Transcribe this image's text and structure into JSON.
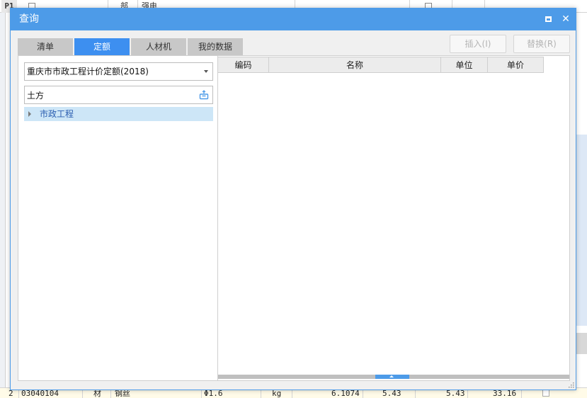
{
  "background": {
    "top_row": {
      "row_id": "P1",
      "type": "部",
      "name": "强电"
    },
    "bottom_row": {
      "index": "2",
      "code": "03040104",
      "type": "材",
      "name": "钢丝",
      "spec": "Φ1.6",
      "unit": "kg",
      "qty": "6.1074",
      "price1": "5.43",
      "price2": "5.43",
      "total": "33.16"
    }
  },
  "dialog": {
    "title": "查询",
    "maximize_icon": "maximize-icon",
    "close_icon": "close-icon",
    "close_glyph": "✕",
    "tabs": [
      {
        "label": "清单",
        "active": false
      },
      {
        "label": "定额",
        "active": true
      },
      {
        "label": "人材机",
        "active": false
      },
      {
        "label": "我的数据",
        "active": false
      }
    ],
    "insert_label": "插入(I)",
    "replace_label": "替换(R)",
    "library_select": {
      "value": "重庆市市政工程计价定额(2018)"
    },
    "search": {
      "value": "土方",
      "icon": "search-icon"
    },
    "tree": [
      {
        "label": "市政工程",
        "selected": true
      }
    ],
    "grid": {
      "columns": [
        "编码",
        "名称",
        "单位",
        "单价"
      ],
      "rows": []
    }
  },
  "colors": {
    "accent": "#4d9be8",
    "tab_active": "#3d8ff0",
    "tree_selected": "#cde6f7"
  }
}
